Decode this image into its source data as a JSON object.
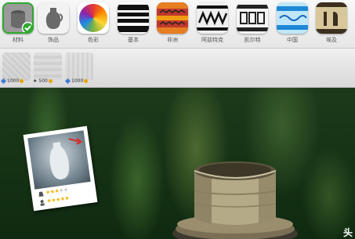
{
  "categories": [
    {
      "id": "material",
      "label": "材料",
      "selected": true,
      "icon": "pot-material-icon"
    },
    {
      "id": "decoration",
      "label": "饰品",
      "icon": "vase-icon"
    },
    {
      "id": "color",
      "label": "色彩",
      "icon": "color-wheel-icon"
    },
    {
      "id": "basic",
      "label": "基本",
      "icon": "stripes-icon"
    },
    {
      "id": "africa",
      "label": "非洲",
      "icon": "african-pattern-icon"
    },
    {
      "id": "aztec",
      "label": "阿兹特克",
      "icon": "aztec-pattern-icon"
    },
    {
      "id": "celtic",
      "label": "凯尔特",
      "icon": "celtic-pattern-icon"
    },
    {
      "id": "china",
      "label": "中国",
      "icon": "chinese-pattern-icon"
    },
    {
      "id": "egypt",
      "label": "埃及",
      "icon": "egyptian-pattern-icon"
    }
  ],
  "items": [
    {
      "price": "1000"
    },
    {
      "price": "500"
    },
    {
      "price": "1000"
    }
  ],
  "card": {
    "rating_top_stars": 3,
    "rating_bottom_stars": 5
  },
  "corner_text": "头",
  "colors": {
    "accent_check": "#2eaa2e",
    "coin": "#e8a400",
    "star": "#f3b300"
  }
}
